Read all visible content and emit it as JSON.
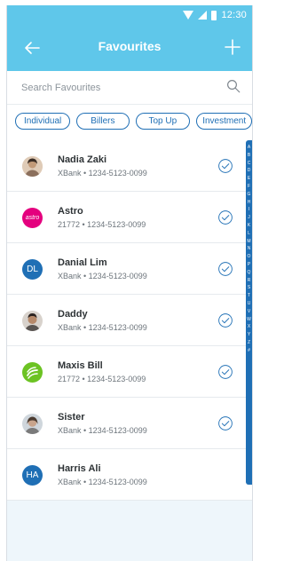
{
  "status_bar": {
    "time": "12:30"
  },
  "app_bar": {
    "title": "Favourites"
  },
  "search": {
    "placeholder": "Search Favourites"
  },
  "filters": [
    "Individual",
    "Billers",
    "Top Up",
    "Investment"
  ],
  "contacts": [
    {
      "name": "Nadia Zaki",
      "account": "XBank • 1234-5123-0099",
      "avatar": "photo",
      "avatar_color": "#c9a583"
    },
    {
      "name": "Astro",
      "account": "21772 • 1234-5123-0099",
      "avatar": "astro-logo",
      "avatar_text": "astro",
      "avatar_color": "#e4007e"
    },
    {
      "name": "Danial Lim",
      "account": "XBank • 1234-5123-0099",
      "avatar": "initials",
      "avatar_text": "DL",
      "avatar_color": "#1f6fb5"
    },
    {
      "name": "Daddy",
      "account": "XBank • 1234-5123-0099",
      "avatar": "photo",
      "avatar_color": "#a37b5c"
    },
    {
      "name": "Maxis Bill",
      "account": "21772 • 1234-5123-0099",
      "avatar": "maxis-logo",
      "avatar_color": "#6cc323"
    },
    {
      "name": "Sister",
      "account": "XBank • 1234-5123-0099",
      "avatar": "photo",
      "avatar_color": "#8e8e8e"
    },
    {
      "name": "Harris Ali",
      "account": "XBank • 1234-5123-0099",
      "avatar": "initials",
      "avatar_text": "HA",
      "avatar_color": "#1f6fb5"
    }
  ],
  "alphabet_index": [
    "A",
    "B",
    "C",
    "D",
    "E",
    "F",
    "G",
    "H",
    "I",
    "J",
    "K",
    "L",
    "M",
    "N",
    "O",
    "P",
    "Q",
    "R",
    "S",
    "T",
    "U",
    "V",
    "W",
    "X",
    "Y",
    "Z",
    "#"
  ],
  "colors": {
    "header": "#5fc7ea",
    "accent": "#1f6fb5",
    "list_bg": "#eef6fb"
  }
}
